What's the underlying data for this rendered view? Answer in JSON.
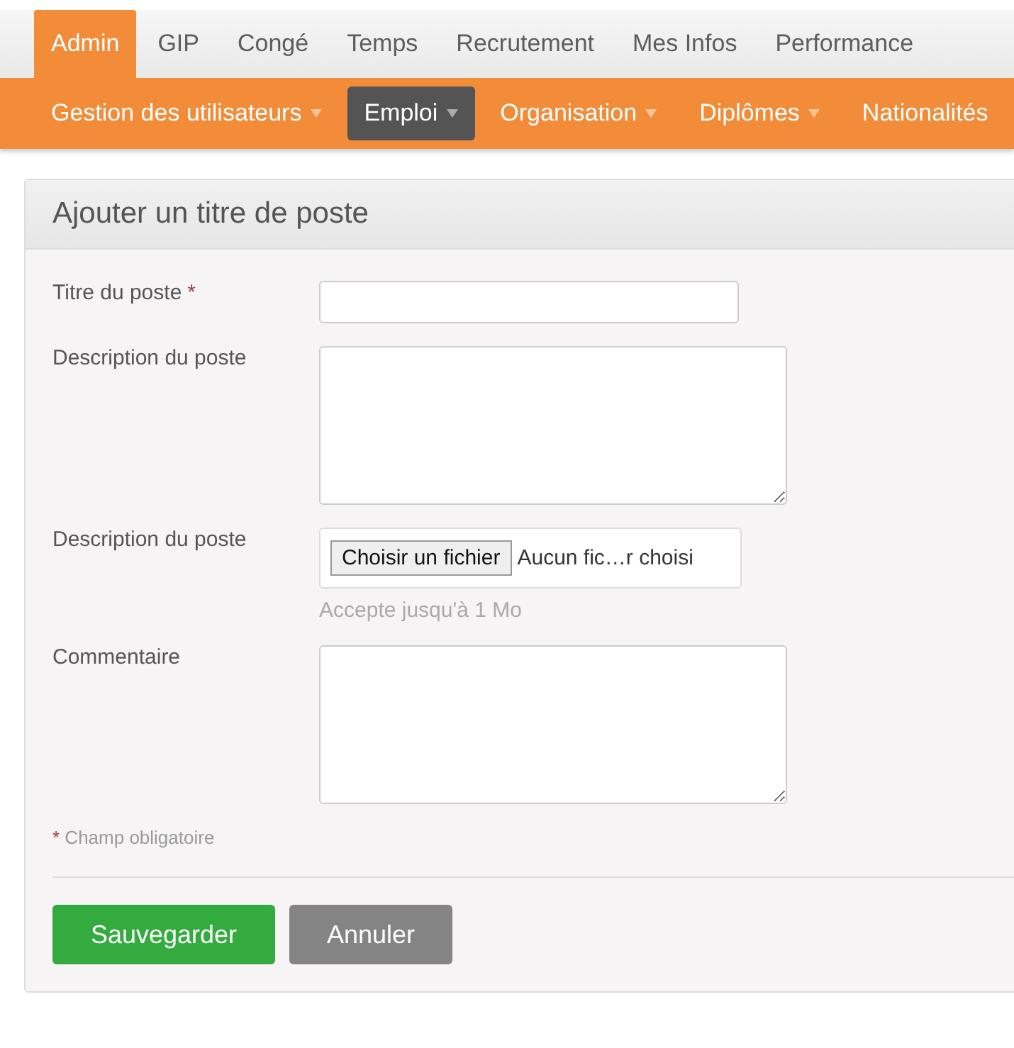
{
  "main_menu": [
    {
      "label": "Admin",
      "selected": true
    },
    {
      "label": "GIP",
      "selected": false
    },
    {
      "label": "Congé",
      "selected": false
    },
    {
      "label": "Temps",
      "selected": false
    },
    {
      "label": "Recrutement",
      "selected": false
    },
    {
      "label": "Mes Infos",
      "selected": false
    },
    {
      "label": "Performance",
      "selected": false
    }
  ],
  "sub_menu": [
    {
      "label": "Gestion des utilisateurs",
      "selected": false,
      "dropdown": true
    },
    {
      "label": "Emploi",
      "selected": true,
      "dropdown": true
    },
    {
      "label": "Organisation",
      "selected": false,
      "dropdown": true
    },
    {
      "label": "Diplômes",
      "selected": false,
      "dropdown": true
    },
    {
      "label": "Nationalités",
      "selected": false,
      "dropdown": false
    }
  ],
  "panel": {
    "title": "Ajouter un titre de poste",
    "fields": [
      {
        "kind": "text",
        "label": "Titre du poste",
        "required_mark": "*"
      },
      {
        "kind": "textarea",
        "label": "Description du poste"
      },
      {
        "kind": "file",
        "label": "Description du poste",
        "button": "Choisir un fichier",
        "status": "Aucun fic…r choisi",
        "hint": "Accepte jusqu'à 1 Mo"
      },
      {
        "kind": "textarea",
        "label": "Commentaire"
      }
    ],
    "required_note": {
      "mark": "*",
      "text": "Champ obligatoire"
    },
    "buttons": [
      {
        "label": "Sauvegarder",
        "kind": "primary"
      },
      {
        "label": "Annuler",
        "kind": "secondary"
      }
    ]
  }
}
